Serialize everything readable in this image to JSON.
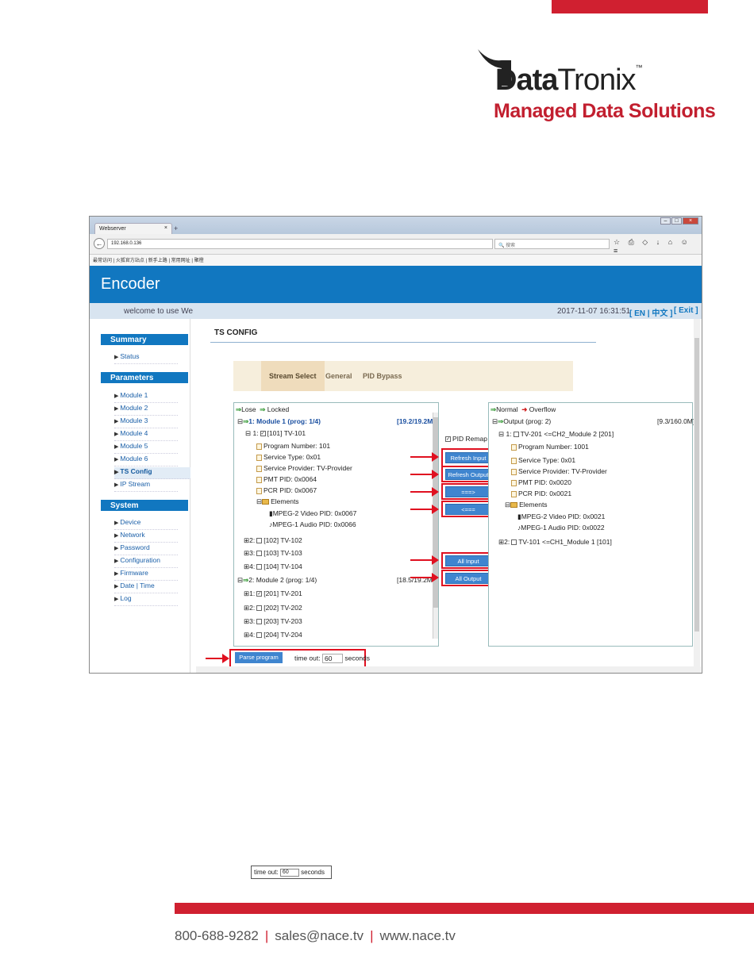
{
  "brand": {
    "name_bold": "Data",
    "name_rest": "Tronix",
    "tm": "™",
    "prefix": "T",
    "tagline": "Managed Data Solutions"
  },
  "browser": {
    "tab_title": "Webserver",
    "tab_close": "×",
    "tab_add": "+",
    "url": "192.168.0.136",
    "search_placeholder": "搜索",
    "bookmarks": "最常访问 | 火狐官方站点 | 新手上路 | 常用网址 | 聚橙"
  },
  "app": {
    "title": "Encoder",
    "welcome": "welcome to use We",
    "datetime": "2017-11-07 16:31:51",
    "lang": "[ EN | 中文 ]",
    "exit": "[ Exit ]"
  },
  "sidebar": {
    "summary": "Summary",
    "summary_items": [
      "Status"
    ],
    "parameters": "Parameters",
    "parameter_items": [
      "Module 1",
      "Module 2",
      "Module 3",
      "Module 4",
      "Module 5",
      "Module 6",
      "TS Config",
      "IP Stream"
    ],
    "system": "System",
    "system_items": [
      "Device",
      "Network",
      "Password",
      "Configuration",
      "Firmware",
      "Date | Time",
      "Log"
    ]
  },
  "ts": {
    "title": "TS CONFIG",
    "tabs": [
      "Stream Select",
      "General",
      "PID Bypass"
    ],
    "left": {
      "legend_lose": "Lose",
      "legend_locked": "Locked",
      "rows": [
        "1: Module 1 (prog: 1/4)",
        "[19.2/19.2M]",
        "1:",
        "[101] TV-101",
        "Program Number: 101",
        "Service Type: 0x01",
        "Service Provider: TV-Provider",
        "PMT PID: 0x0064",
        "PCR PID: 0x0067",
        "Elements",
        "MPEG-2 Video PID: 0x0067",
        "MPEG-1 Audio PID: 0x0066",
        "2:",
        "[102] TV-102",
        "3:",
        "[103] TV-103",
        "4:",
        "[104] TV-104",
        "2: Module 2 (prog: 1/4)",
        "[18.5/19.2M]",
        "1:",
        "[201] TV-201",
        "2:",
        "[202] TV-202",
        "3:",
        "[203] TV-203",
        "4:",
        "[204] TV-204"
      ]
    },
    "right": {
      "legend_normal": "Normal",
      "legend_overflow": "Overflow",
      "rows": [
        "Output (prog: 2)",
        "[9.3/160.0M]",
        "1:",
        "TV-201 <=CH2_Module 2 [201]",
        "Program Number: 1001",
        "Service Type: 0x01",
        "Service Provider: TV-Provider",
        "PMT PID: 0x0020",
        "PCR PID: 0x0021",
        "Elements",
        "MPEG-2 Video PID: 0x0021",
        "MPEG-1 Audio PID: 0x0022",
        "2:",
        "TV-101 <=CH1_Module 1 [101]"
      ]
    },
    "pid_remap": "PID Remap",
    "buttons": [
      "Refresh Input",
      "Refresh Output",
      "===>",
      "<===",
      "All Input",
      "All Output"
    ],
    "parse_button": "Parse program",
    "timeout_label": "time out:",
    "timeout_value": "60",
    "timeout_unit": "seconds"
  },
  "snippet": {
    "label": "time out:",
    "value": "60",
    "unit": "seconds"
  },
  "footer": {
    "phone": "800-688-9282",
    "email": "sales@nace.tv",
    "web": "www.nace.tv",
    "sep": "|"
  },
  "colors": {
    "accent_red": "#d02030",
    "app_blue": "#1177c0"
  }
}
